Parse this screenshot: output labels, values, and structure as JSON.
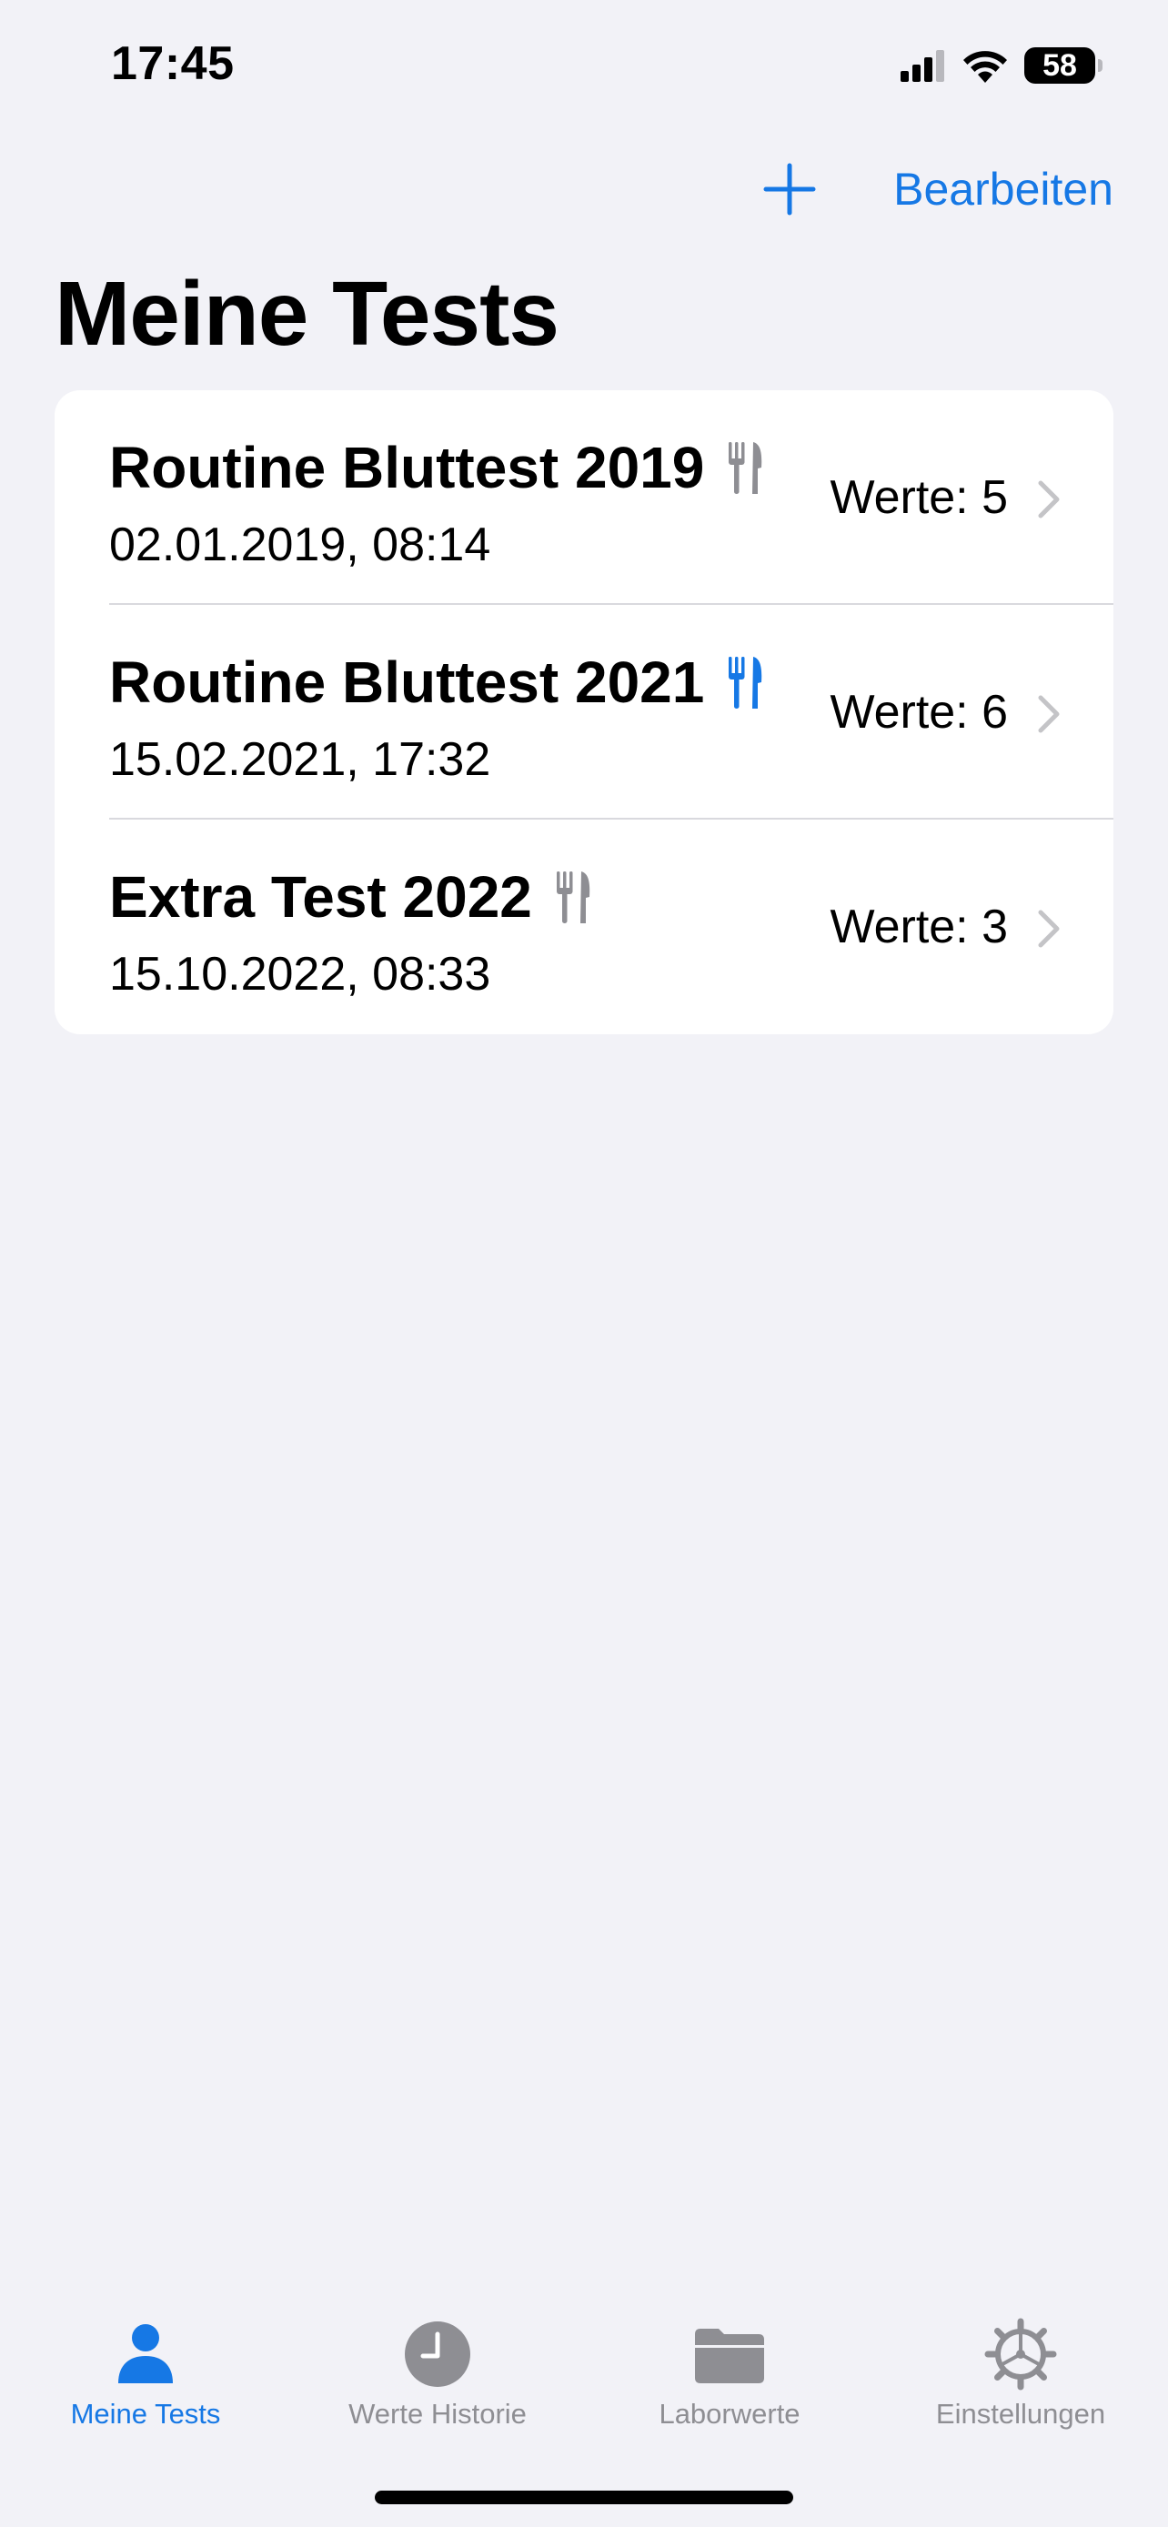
{
  "status_bar": {
    "time": "17:45",
    "battery": "58",
    "icons": [
      "signal-icon",
      "wifi-icon",
      "battery-icon"
    ]
  },
  "nav": {
    "add_icon": "plus-icon",
    "edit_label": "Bearbeiten",
    "title": "Meine Tests"
  },
  "tests": [
    {
      "title": "Routine Bluttest 2019",
      "date": "02.01.2019, 08:14",
      "values": "Werte: 5",
      "fasting_icon_color": "#8e8e93"
    },
    {
      "title": "Routine Bluttest 2021",
      "date": "15.02.2021, 17:32",
      "values": "Werte: 6",
      "fasting_icon_color": "#1678e5"
    },
    {
      "title": "Extra Test 2022",
      "date": "15.10.2022, 08:33",
      "values": "Werte: 3",
      "fasting_icon_color": "#8e8e93"
    }
  ],
  "tabbar": {
    "tabs": [
      {
        "label": "Meine Tests",
        "icon": "person-icon",
        "active": true
      },
      {
        "label": "Werte Historie",
        "icon": "clock-icon",
        "active": false
      },
      {
        "label": "Laborwerte",
        "icon": "folder-icon",
        "active": false
      },
      {
        "label": "Einstellungen",
        "icon": "gear-icon",
        "active": false
      }
    ]
  },
  "colors": {
    "accent": "#1678e5",
    "inactive": "#8e8e93",
    "background": "#f2f2f7"
  }
}
